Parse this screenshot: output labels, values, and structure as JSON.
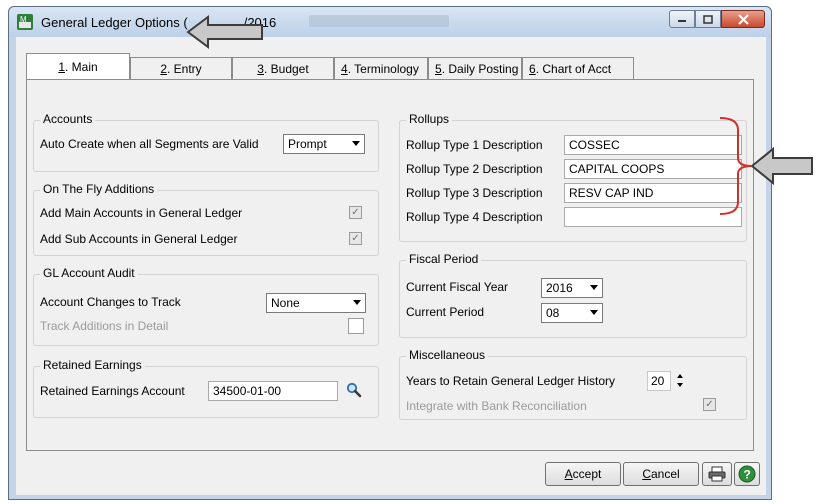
{
  "window": {
    "title": "General Ledger Options (",
    "title_suffix": "/2016"
  },
  "tabs": [
    {
      "accel": "1",
      "label": ". Main"
    },
    {
      "accel": "2",
      "label": ". Entry"
    },
    {
      "accel": "3",
      "label": ". Budget"
    },
    {
      "accel": "4",
      "label": ". Terminology"
    },
    {
      "accel": "5",
      "label": ". Daily Posting"
    },
    {
      "accel": "6",
      "label": ". Chart of Acct"
    }
  ],
  "accounts": {
    "title": "Accounts",
    "auto_create_label": "Auto Create when all Segments are Valid",
    "auto_create_value": "Prompt"
  },
  "on_the_fly": {
    "title": "On The Fly Additions",
    "main_label": "Add Main Accounts in General Ledger",
    "sub_label": "Add Sub Accounts in General Ledger",
    "main_checked": true,
    "sub_checked": true
  },
  "audit": {
    "title": "GL Account Audit",
    "changes_label": "Account Changes to Track",
    "changes_value": "None",
    "track_additions_label": "Track Additions in Detail"
  },
  "retained": {
    "title": "Retained Earnings",
    "account_label": "Retained Earnings Account",
    "account_value": "34500-01-00"
  },
  "rollups": {
    "title": "Rollups",
    "rows": [
      {
        "label": "Rollup Type 1 Description",
        "value": "COSSEC"
      },
      {
        "label": "Rollup Type 2 Description",
        "value": "CAPITAL COOPS"
      },
      {
        "label": "Rollup Type 3 Description",
        "value": "RESV CAP IND"
      },
      {
        "label": "Rollup Type 4 Description",
        "value": ""
      }
    ]
  },
  "fiscal": {
    "title": "Fiscal Period",
    "year_label": "Current Fiscal Year",
    "year_value": "2016",
    "period_label": "Current Period",
    "period_value": "08"
  },
  "misc": {
    "title": "Miscellaneous",
    "years_label": "Years to Retain General Ledger History",
    "years_value": "20",
    "bank_label": "Integrate with Bank Reconciliation"
  },
  "buttons": {
    "accept_accel": "A",
    "accept_rest": "ccept",
    "cancel_accel": "C",
    "cancel_rest": "ancel"
  },
  "colors": {
    "annotation_red": "#d0312d",
    "window_frame": "#c4d4e6"
  },
  "icons": [
    "app-icon",
    "minimize-icon",
    "maximize-icon",
    "close-icon",
    "lookup-magnifier-icon",
    "printer-icon",
    "help-icon",
    "annotation-arrow-icon"
  ]
}
